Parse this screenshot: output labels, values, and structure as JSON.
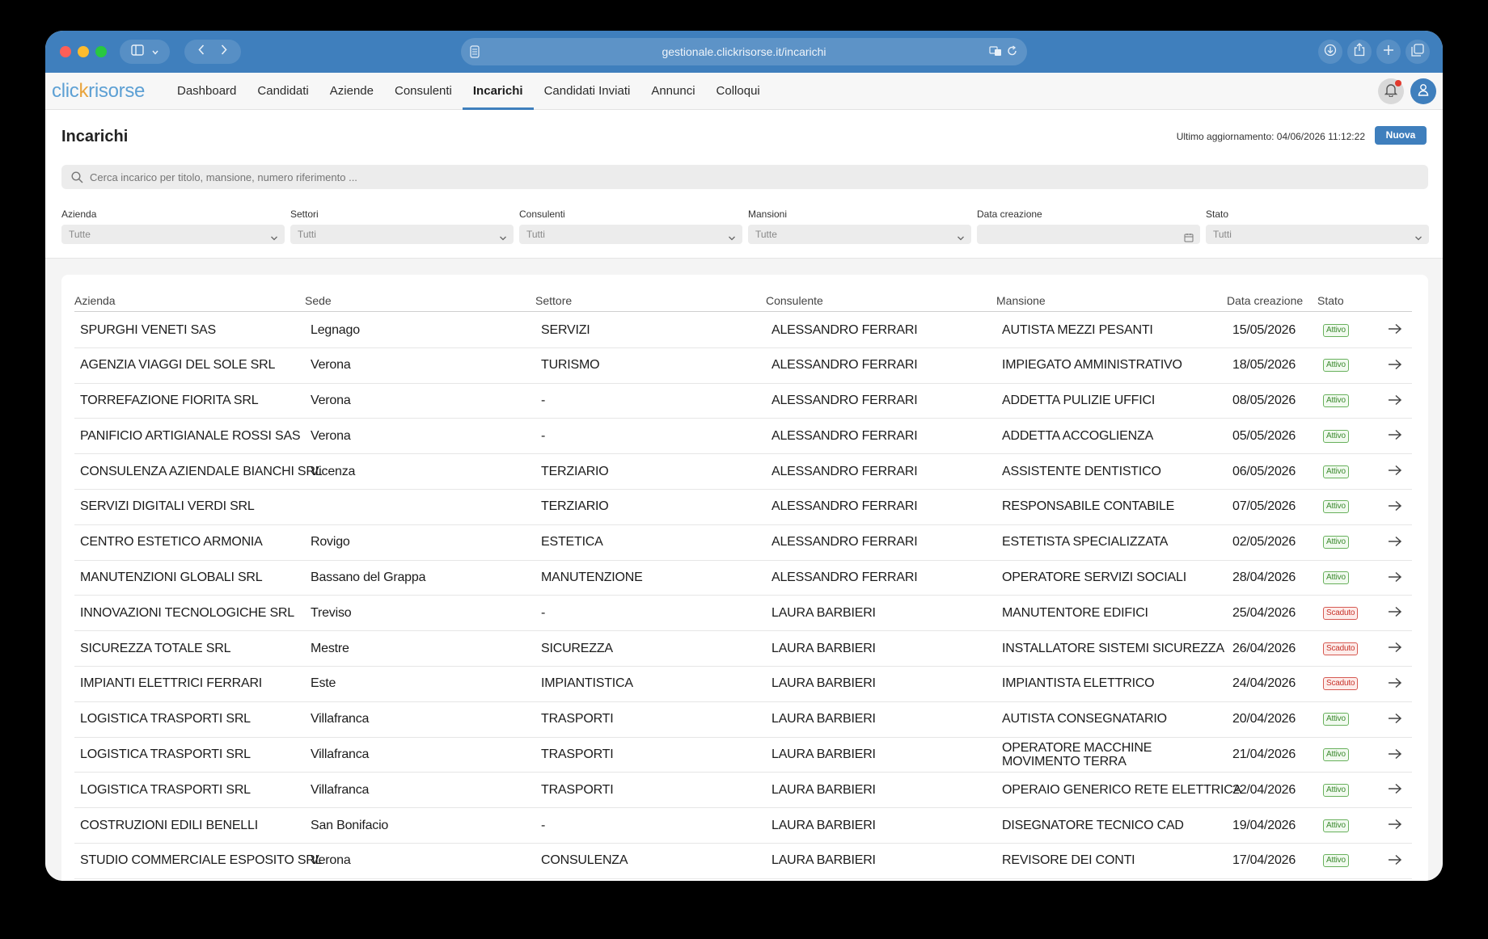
{
  "browser": {
    "url": "gestionale.clickrisorse.it/incarichi"
  },
  "app": {
    "logo": {
      "part1": "clic",
      "part2": "k",
      "part3": "risorse"
    },
    "nav": [
      {
        "label": "Dashboard",
        "active": false
      },
      {
        "label": "Candidati",
        "active": false
      },
      {
        "label": "Aziende",
        "active": false
      },
      {
        "label": "Consulenti",
        "active": false
      },
      {
        "label": "Incarichi",
        "active": true
      },
      {
        "label": "Candidati Inviati",
        "active": false
      },
      {
        "label": "Annunci",
        "active": false
      },
      {
        "label": "Colloqui",
        "active": false
      }
    ],
    "accent_color": "#3f7fbd"
  },
  "page": {
    "title": "Incarichi",
    "last_update": "Ultimo aggiornamento: 04/06/2026 11:12:22",
    "new_button": "Nuova",
    "search_placeholder": "Cerca incarico per titolo, mansione, numero riferimento ..."
  },
  "filters": [
    {
      "label": "Azienda",
      "value": "Tutte",
      "icon": "chevron-down-icon"
    },
    {
      "label": "Settori",
      "value": "Tutti",
      "icon": "chevron-down-icon"
    },
    {
      "label": "Consulenti",
      "value": "Tutti",
      "icon": "chevron-down-icon"
    },
    {
      "label": "Mansioni",
      "value": "Tutte",
      "icon": "chevron-down-icon"
    },
    {
      "label": "Data creazione",
      "value": "",
      "icon": "calendar-icon"
    },
    {
      "label": "Stato",
      "value": "Tutti",
      "icon": "chevron-down-icon"
    }
  ],
  "table": {
    "columns": [
      "Azienda",
      "Sede",
      "Settore",
      "Consulente",
      "Mansione",
      "Data creazione",
      "Stato"
    ],
    "rows": [
      {
        "azienda": "SPURGHI VENETI SAS",
        "sede": "Legnago",
        "settore": "SERVIZI",
        "consulente": "ALESSANDRO FERRARI",
        "mansione": "AUTISTA MEZZI PESANTI",
        "data": "15/05/2026",
        "stato": "Attivo"
      },
      {
        "azienda": "AGENZIA VIAGGI DEL SOLE SRL",
        "sede": "Verona",
        "settore": "TURISMO",
        "consulente": "ALESSANDRO FERRARI",
        "mansione": "IMPIEGATO AMMINISTRATIVO",
        "data": "18/05/2026",
        "stato": "Attivo"
      },
      {
        "azienda": "TORREFAZIONE FIORITA SRL",
        "sede": "Verona",
        "settore": "-",
        "consulente": "ALESSANDRO FERRARI",
        "mansione": "ADDETTA PULIZIE UFFICI",
        "data": "08/05/2026",
        "stato": "Attivo"
      },
      {
        "azienda": "PANIFICIO ARTIGIANALE ROSSI SAS",
        "sede": "Verona",
        "settore": "-",
        "consulente": "ALESSANDRO FERRARI",
        "mansione": "ADDETTA ACCOGLIENZA",
        "data": "05/05/2026",
        "stato": "Attivo"
      },
      {
        "azienda": "CONSULENZA AZIENDALE BIANCHI SRL",
        "sede": "Vicenza",
        "settore": "TERZIARIO",
        "consulente": "ALESSANDRO FERRARI",
        "mansione": "ASSISTENTE DENTISTICO",
        "data": "06/05/2026",
        "stato": "Attivo"
      },
      {
        "azienda": "SERVIZI DIGITALI VERDI SRL",
        "sede": "",
        "settore": "TERZIARIO",
        "consulente": "ALESSANDRO FERRARI",
        "mansione": "RESPONSABILE CONTABILE",
        "data": "07/05/2026",
        "stato": "Attivo"
      },
      {
        "azienda": "CENTRO ESTETICO ARMONIA",
        "sede": "Rovigo",
        "settore": "ESTETICA",
        "consulente": "ALESSANDRO FERRARI",
        "mansione": "ESTETISTA SPECIALIZZATA",
        "data": "02/05/2026",
        "stato": "Attivo"
      },
      {
        "azienda": "MANUTENZIONI GLOBALI SRL",
        "sede": "Bassano del Grappa",
        "settore": "MANUTENZIONE",
        "consulente": "ALESSANDRO FERRARI",
        "mansione": "OPERATORE SERVIZI SOCIALI",
        "data": "28/04/2026",
        "stato": "Attivo"
      },
      {
        "azienda": "INNOVAZIONI TECNOLOGICHE SRL",
        "sede": "Treviso",
        "settore": "-",
        "consulente": "LAURA BARBIERI",
        "mansione": "MANUTENTORE EDIFICI",
        "data": "25/04/2026",
        "stato": "Scaduto"
      },
      {
        "azienda": "SICUREZZA TOTALE SRL",
        "sede": "Mestre",
        "settore": "SICUREZZA",
        "consulente": "LAURA BARBIERI",
        "mansione": "INSTALLATORE SISTEMI SICUREZZA",
        "data": "26/04/2026",
        "stato": "Scaduto"
      },
      {
        "azienda": "IMPIANTI ELETTRICI FERRARI",
        "sede": "Este",
        "settore": "IMPIANTISTICA",
        "consulente": "LAURA BARBIERI",
        "mansione": "IMPIANTISTA ELETTRICO",
        "data": "24/04/2026",
        "stato": "Scaduto"
      },
      {
        "azienda": "LOGISTICA TRASPORTI SRL",
        "sede": "Villafranca",
        "settore": "TRASPORTI",
        "consulente": "LAURA BARBIERI",
        "mansione": "AUTISTA CONSEGNATARIO",
        "data": "20/04/2026",
        "stato": "Attivo"
      },
      {
        "azienda": "LOGISTICA TRASPORTI SRL",
        "sede": "Villafranca",
        "settore": "TRASPORTI",
        "consulente": "LAURA BARBIERI",
        "mansione": "OPERATORE MACCHINE MOVIMENTO TERRA",
        "data": "21/04/2026",
        "stato": "Attivo"
      },
      {
        "azienda": "LOGISTICA TRASPORTI SRL",
        "sede": "Villafranca",
        "settore": "TRASPORTI",
        "consulente": "LAURA BARBIERI",
        "mansione": "OPERAIO GENERICO RETE ELETTRICA",
        "data": "22/04/2026",
        "stato": "Attivo"
      },
      {
        "azienda": "COSTRUZIONI EDILI BENELLI",
        "sede": "San Bonifacio",
        "settore": "-",
        "consulente": "LAURA BARBIERI",
        "mansione": "DISEGNATORE TECNICO CAD",
        "data": "19/04/2026",
        "stato": "Attivo"
      },
      {
        "azienda": "STUDIO COMMERCIALE ESPOSITO SRL",
        "sede": "Verona",
        "settore": "CONSULENZA",
        "consulente": "LAURA BARBIERI",
        "mansione": "REVISORE DEI CONTI",
        "data": "17/04/2026",
        "stato": "Attivo"
      }
    ]
  }
}
